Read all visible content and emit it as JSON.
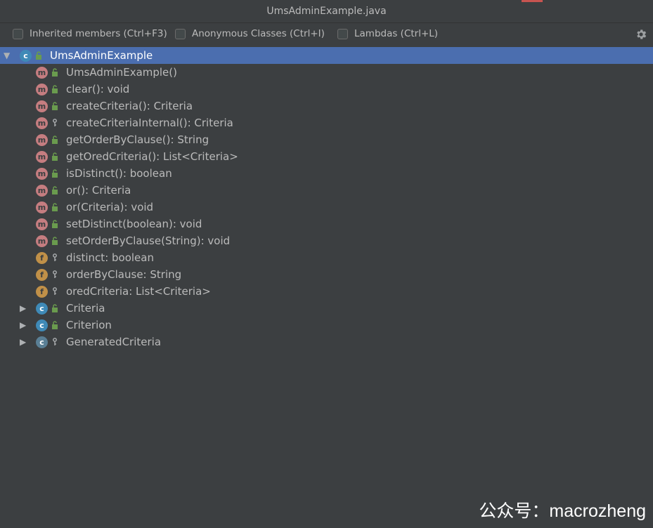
{
  "window": {
    "title": "UmsAdminExample.java"
  },
  "toolbar": {
    "options": [
      {
        "label": "Inherited members (Ctrl+F3)",
        "checked": false
      },
      {
        "label": "Anonymous Classes (Ctrl+I)",
        "checked": false
      },
      {
        "label": "Lambdas (Ctrl+L)",
        "checked": false
      }
    ],
    "settings_icon": "gear-icon"
  },
  "tree": {
    "root": {
      "label": "UmsAdminExample",
      "kind": "class",
      "visibility": "public",
      "expanded": true,
      "selected": true
    },
    "members": [
      {
        "label": "UmsAdminExample()",
        "kind": "method",
        "visibility": "public"
      },
      {
        "label": "clear(): void",
        "kind": "method",
        "visibility": "public"
      },
      {
        "label": "createCriteria(): Criteria",
        "kind": "method",
        "visibility": "public"
      },
      {
        "label": "createCriteriaInternal(): Criteria",
        "kind": "method",
        "visibility": "protected"
      },
      {
        "label": "getOrderByClause(): String",
        "kind": "method",
        "visibility": "public"
      },
      {
        "label": "getOredCriteria(): List<Criteria>",
        "kind": "method",
        "visibility": "public"
      },
      {
        "label": "isDistinct(): boolean",
        "kind": "method",
        "visibility": "public"
      },
      {
        "label": "or(): Criteria",
        "kind": "method",
        "visibility": "public"
      },
      {
        "label": "or(Criteria): void",
        "kind": "method",
        "visibility": "public"
      },
      {
        "label": "setDistinct(boolean): void",
        "kind": "method",
        "visibility": "public"
      },
      {
        "label": "setOrderByClause(String): void",
        "kind": "method",
        "visibility": "public"
      },
      {
        "label": "distinct: boolean",
        "kind": "field",
        "visibility": "protected"
      },
      {
        "label": "orderByClause: String",
        "kind": "field",
        "visibility": "protected"
      },
      {
        "label": "oredCriteria: List<Criteria>",
        "kind": "field",
        "visibility": "protected"
      }
    ],
    "nested": [
      {
        "label": "Criteria",
        "kind": "class",
        "visibility": "public",
        "expanded": false
      },
      {
        "label": "Criterion",
        "kind": "class",
        "visibility": "public",
        "expanded": false
      },
      {
        "label": "GeneratedCriteria",
        "kind": "abstract-class",
        "visibility": "protected",
        "expanded": false
      }
    ]
  },
  "colors": {
    "background": "#3c3f41",
    "selection": "#4b6eaf",
    "method_badge": "#c57d80",
    "field_badge": "#c09048",
    "class_badge": "#3f8ab7",
    "public_icon": "#6a9b4e"
  },
  "watermark": "公众号：macrozheng"
}
